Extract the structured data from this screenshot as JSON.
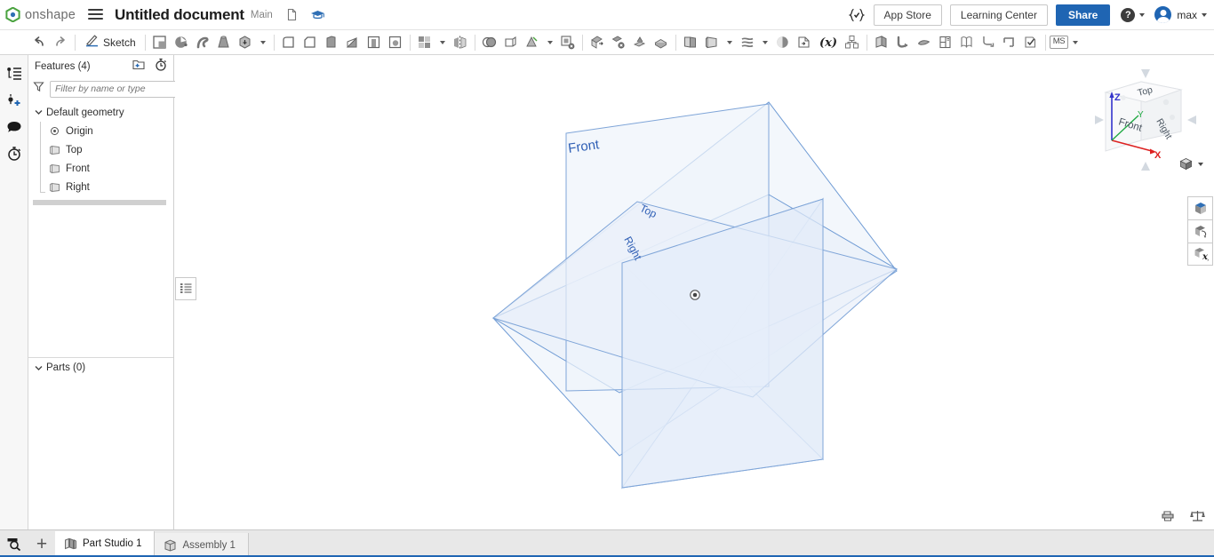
{
  "app": {
    "name": "onshape",
    "logo_icon": "onshape-logo-icon",
    "menu_icon": "hamburger-menu-icon"
  },
  "topbar": {
    "document_title": "Untitled document",
    "branch_label": "Main",
    "copy_icon": "copy-document-icon",
    "graduation_icon": "graduation-cap-icon",
    "featurescript_icon": "featurescript-icon",
    "app_store_label": "App Store",
    "learning_center_label": "Learning Center",
    "share_label": "Share",
    "help_icon": "help-question-icon",
    "help_caret_icon": "chevron-down-icon",
    "avatar_icon": "user-avatar-icon",
    "username": "max",
    "user_caret_icon": "chevron-down-icon",
    "accent_color": "#1f65b3"
  },
  "feature_toolbar": {
    "undo_icon": "undo-arrow-icon",
    "redo_icon": "redo-arrow-icon",
    "sketch_label": "Sketch",
    "sketch_icon": "pencil-sketch-icon",
    "tools": [
      {
        "name": "extrude-icon"
      },
      {
        "name": "revolve-icon"
      },
      {
        "name": "sweep-icon"
      },
      {
        "name": "loft-icon"
      },
      {
        "name": "thicken-icon"
      }
    ],
    "tools_b": [
      {
        "name": "fillet-icon"
      },
      {
        "name": "chamfer-icon"
      },
      {
        "name": "rib-icon"
      },
      {
        "name": "draft-icon"
      },
      {
        "name": "shell-icon"
      },
      {
        "name": "hole-icon"
      }
    ],
    "tools_c": [
      {
        "name": "linear-pattern-icon"
      },
      {
        "name": "mirror-icon"
      }
    ],
    "tools_d": [
      {
        "name": "boolean-icon"
      },
      {
        "name": "split-icon"
      },
      {
        "name": "transform-icon"
      },
      {
        "name": "move-face-icon"
      },
      {
        "name": "delete-face-icon"
      },
      {
        "name": "replace-face-icon"
      },
      {
        "name": "delete-part-icon"
      },
      {
        "name": "enclose-icon"
      },
      {
        "name": "offset-surface-icon"
      }
    ],
    "tools_e": [
      {
        "name": "sheet-metal-icon"
      },
      {
        "name": "plane-icon"
      },
      {
        "name": "curve-pattern-icon"
      },
      {
        "name": "helix-icon"
      },
      {
        "name": "variable-icon"
      },
      {
        "name": "assembly-feature-icon"
      }
    ],
    "tools_f": [
      {
        "name": "composite-part-icon"
      },
      {
        "name": "derive-icon"
      },
      {
        "name": "import-icon"
      },
      {
        "name": "configuration-icon"
      },
      {
        "name": "open-book-icon"
      },
      {
        "name": "bend-icon"
      },
      {
        "name": "flange-icon"
      },
      {
        "name": "approve-icon"
      }
    ],
    "units_label": "MS",
    "units_caret_icon": "chevron-down-icon"
  },
  "left_rail": {
    "items": [
      {
        "name": "feature-list-icon"
      },
      {
        "name": "add-instance-icon"
      },
      {
        "name": "comments-icon"
      },
      {
        "name": "version-history-icon"
      }
    ],
    "bottom_item": {
      "name": "search-part-icon"
    }
  },
  "feature_panel": {
    "title": "Features (4)",
    "add_folder_icon": "add-folder-icon",
    "rollback-timer_icon": "stopwatch-icon",
    "filter_icon": "funnel-filter-icon",
    "filter_placeholder": "Filter by name or type",
    "filter_value": "",
    "tree": [
      {
        "label": "Default geometry",
        "icon": "chevron-down-icon",
        "level": 0,
        "type": "folder"
      },
      {
        "label": "Origin",
        "icon": "origin-icon",
        "level": 1,
        "type": "item"
      },
      {
        "label": "Top",
        "icon": "plane-icon",
        "level": 1,
        "type": "item"
      },
      {
        "label": "Front",
        "icon": "plane-icon",
        "level": 1,
        "type": "item"
      },
      {
        "label": "Right",
        "icon": "plane-icon",
        "level": 1,
        "type": "item"
      }
    ],
    "parts_label": "Parts (0)",
    "parts_chevron_icon": "chevron-down-icon",
    "collapse_toggle_icon": "panel-list-icon"
  },
  "viewport": {
    "background_color": "#ffffff",
    "plane_color": "#3b6fbb",
    "plane_fill": "#eaf0f9",
    "origin_marker_icon": "origin-point-icon",
    "planes": [
      {
        "label": "Front"
      },
      {
        "label": "Top"
      },
      {
        "label": "Right"
      }
    ],
    "viewcube": {
      "icon": "view-cube-icon",
      "faces": [
        "Top",
        "Front",
        "Right"
      ],
      "axes": [
        {
          "label": "Z",
          "color": "#2f2fd0"
        },
        {
          "label": "X",
          "color": "#e02020"
        },
        {
          "label": "Y",
          "color": "#1faa4b"
        }
      ],
      "arrow_icons": [
        "rotate-left-arrow-icon",
        "rotate-right-arrow-icon",
        "pan-up-arrow-icon",
        "pan-down-arrow-icon",
        "pan-left-arrow-icon",
        "pan-right-arrow-icon"
      ]
    },
    "display_style": {
      "icon": "shaded-cube-icon",
      "caret_icon": "chevron-down-icon"
    },
    "right_tools": [
      {
        "name": "render-icon"
      },
      {
        "name": "section-view-icon"
      },
      {
        "name": "measure-variable-icon"
      }
    ],
    "bottom_right_tools": [
      {
        "name": "print-3d-icon"
      },
      {
        "name": "mass-properties-icon"
      }
    ]
  },
  "tabbar": {
    "search_icon": "search-tabs-icon",
    "add_icon": "add-tab-icon",
    "add_label": "+",
    "tabs": [
      {
        "label": "Part Studio 1",
        "icon": "part-studio-icon",
        "active": true
      },
      {
        "label": "Assembly 1",
        "icon": "assembly-icon",
        "active": false
      }
    ]
  }
}
